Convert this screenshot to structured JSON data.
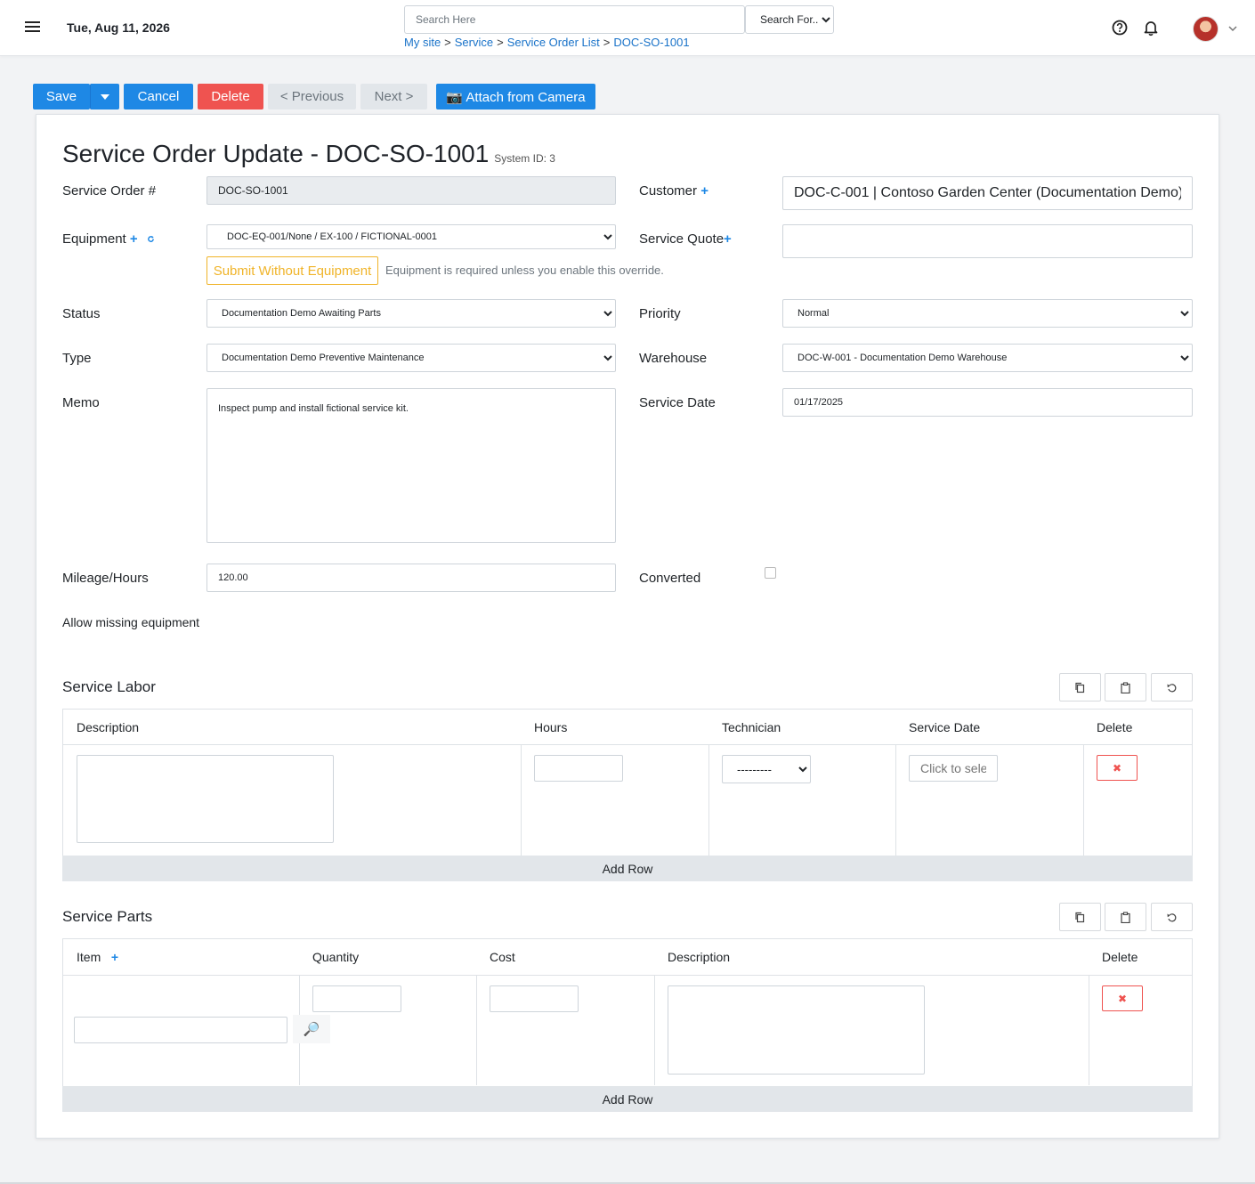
{
  "header": {
    "date": "Tue, Aug 11, 2026",
    "search_placeholder": "Search Here",
    "search_for": "Search For...",
    "breadcrumb": [
      "My site",
      "Service",
      "Service Order List",
      "DOC-SO-1001"
    ],
    "breadcrumb_separator": ">"
  },
  "toolbar": {
    "save": "Save",
    "cancel": "Cancel",
    "delete": "Delete",
    "previous": "< Previous",
    "next": "Next >",
    "camera": "📷 Attach from Camera"
  },
  "form": {
    "title": "Service Order Update - DOC-SO-1001",
    "system_id": "System ID: 3",
    "labels": {
      "service_order": "Service Order #",
      "customer": "Customer",
      "equipment": "Equipment",
      "service_quote": "Service Quote",
      "status": "Status",
      "priority": "Priority",
      "type": "Type",
      "warehouse": "Warehouse",
      "memo": "Memo",
      "service_date": "Service Date",
      "mileage": "Mileage/Hours",
      "converted": "Converted",
      "allow_missing": "Allow missing equipment"
    },
    "values": {
      "service_order": "DOC-SO-1001",
      "customer": "DOC-C-001 | Contoso Garden Center (Documentation Demo)",
      "equipment": "DOC-EQ-001/None / EX-100 / FICTIONAL-0001",
      "service_quote": "",
      "status": "Documentation Demo Awaiting Parts",
      "priority": "Normal",
      "type": "Documentation Demo Preventive Maintenance",
      "warehouse": "DOC-W-001 - Documentation Demo Warehouse",
      "memo": "Inspect pump and install fictional service kit.",
      "service_date": "01/17/2025",
      "mileage": "120.00"
    },
    "override_button": "Submit Without Equipment",
    "override_help": "Equipment is required unless you enable this override.",
    "plus_symbol": "+"
  },
  "labor": {
    "title": "Service Labor",
    "columns": [
      "Description",
      "Hours",
      "Technician",
      "Service Date",
      "Delete"
    ],
    "technician_default": "---------",
    "date_placeholder": "Click to select",
    "add_row": "Add Row",
    "delete_symbol": "✖"
  },
  "parts": {
    "title": "Service Parts",
    "columns": [
      "Item",
      "Quantity",
      "Cost",
      "Description",
      "Delete"
    ],
    "item_plus": "+",
    "lookup_symbol": "🔎",
    "add_row": "Add Row",
    "delete_symbol": "✖"
  },
  "colors": {
    "primary": "#1e88e5",
    "danger": "#ef5350",
    "warning": "#f0b429",
    "link": "#1a73c9"
  }
}
